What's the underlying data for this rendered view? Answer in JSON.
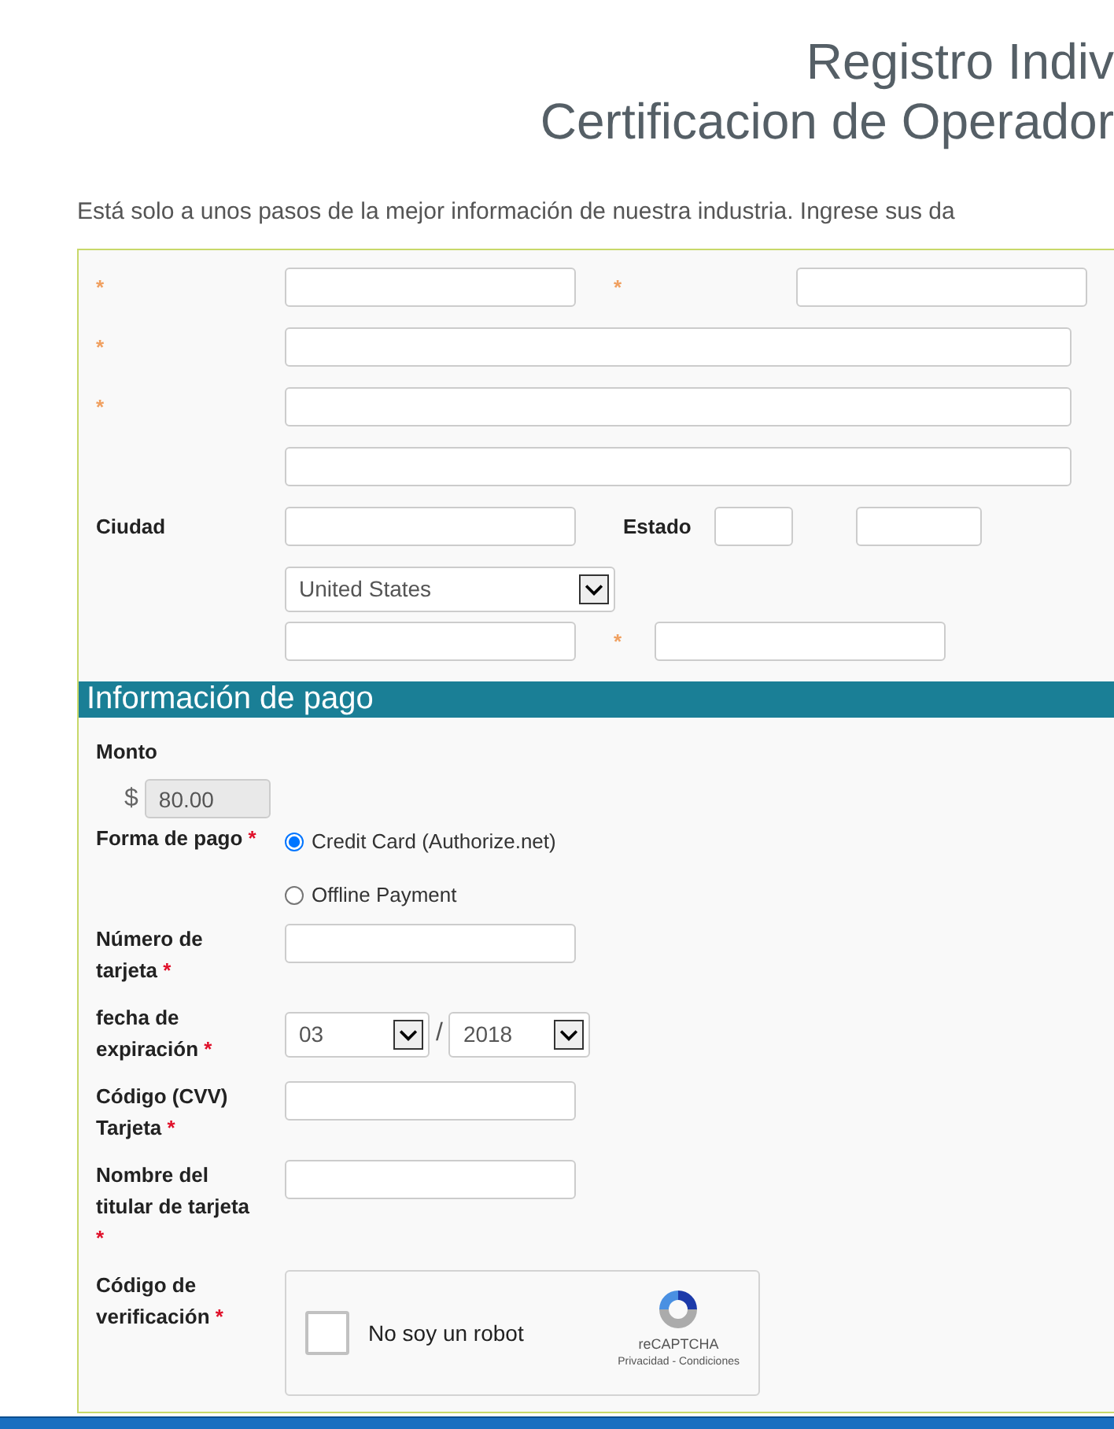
{
  "header": {
    "title_lines": [
      "Registro Indiv",
      "Certificacion de Operador"
    ],
    "intro": "Está solo a unos pasos de la mejor información de nuestra industria. Ingrese sus da"
  },
  "address_rows": [
    {
      "kind": "pair",
      "mark": "*",
      "second_mark": "*"
    },
    {
      "kind": "wide",
      "mark": "*"
    },
    {
      "kind": "wide",
      "mark": "*"
    },
    {
      "kind": "wide"
    },
    {
      "kind": "city",
      "label": "Ciudad",
      "second_label": "Estado"
    },
    {
      "kind": "select",
      "value": "United States"
    },
    {
      "kind": "pair_right",
      "second_mark": "*"
    }
  ],
  "payment": {
    "title": "Información de pago",
    "amount": {
      "label": "Monto",
      "currency": "$",
      "value": "80.00",
      "disabled": true
    },
    "method": {
      "label": "Forma de pago",
      "mark": "*",
      "options": [
        {
          "label": "Credit Card (Authorize.net)",
          "selected": true
        },
        {
          "label": "Offline Payment",
          "selected": false
        }
      ]
    },
    "fields": [
      {
        "kind": "input",
        "label": "Número de tarjeta",
        "mark": "*"
      },
      {
        "kind": "expiry",
        "label": "fecha de expiración",
        "mark": "*",
        "month": "03",
        "separator": "/",
        "year": "2018"
      },
      {
        "kind": "input",
        "label": "Código (CVV) Tarjeta",
        "mark": "*"
      },
      {
        "kind": "input",
        "label": "Nombre del titular de tarjeta",
        "mark": "*"
      },
      {
        "kind": "captcha",
        "label": "Código de verificación",
        "mark": "*",
        "checked": false,
        "text": "No soy un robot",
        "brand": "reCAPTCHA",
        "links": "Privacidad - Condiciones"
      }
    ]
  }
}
